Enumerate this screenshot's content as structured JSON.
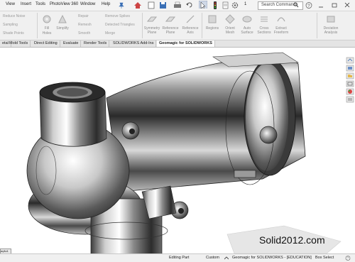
{
  "menu": {
    "items": [
      "View",
      "Insert",
      "Tools",
      "PhotoView 360",
      "Window",
      "Help"
    ],
    "zoom_count": "1",
    "search_placeholder": "Search Commands"
  },
  "ribbon": {
    "small_group1": [
      "Reduce Noise",
      "Sampling",
      "Shade Points"
    ],
    "big1": [
      "Fill",
      "Holes"
    ],
    "big2": "Simplify",
    "small_group2": [
      "Repair",
      "Remesh",
      "Smooth"
    ],
    "small_group3": [
      "Remove Spikes",
      "Detected Triangles",
      "Merge"
    ],
    "big_buttons": [
      {
        "label": "Symmetry Plane",
        "icon": "symmetry-plane-icon"
      },
      {
        "label": "Reference Plane",
        "icon": "reference-plane-icon"
      },
      {
        "label": "Reference Axis",
        "icon": "reference-axis-icon"
      },
      {
        "label": "Regions",
        "icon": "regions-icon"
      },
      {
        "label": "Orient Mesh",
        "icon": "orient-mesh-icon"
      },
      {
        "label": "Auto Surface",
        "icon": "auto-surface-icon"
      },
      {
        "label": "Cross Sections",
        "icon": "cross-sections-icon"
      },
      {
        "label": "Extract Freeform",
        "icon": "extract-freeform-icon"
      },
      {
        "label": "Deviation Analysis",
        "icon": "deviation-analysis-icon"
      }
    ]
  },
  "tabs": [
    "etal",
    "Mold Tools",
    "Direct Editing",
    "Evaluate",
    "Render Tools",
    "SOLIDWORKS Add-Ins",
    "Geomagic for SOLIDWORKS"
  ],
  "active_tab": "Geomagic for SOLIDWORKS",
  "status": {
    "mode": "Editing Part",
    "units": "Custom",
    "license": "Geomagic for SOLIDWORKS - [EDUCATION]",
    "selection": "Box Select",
    "left_tab": "ação1"
  },
  "watermark": "Solid2012.com"
}
